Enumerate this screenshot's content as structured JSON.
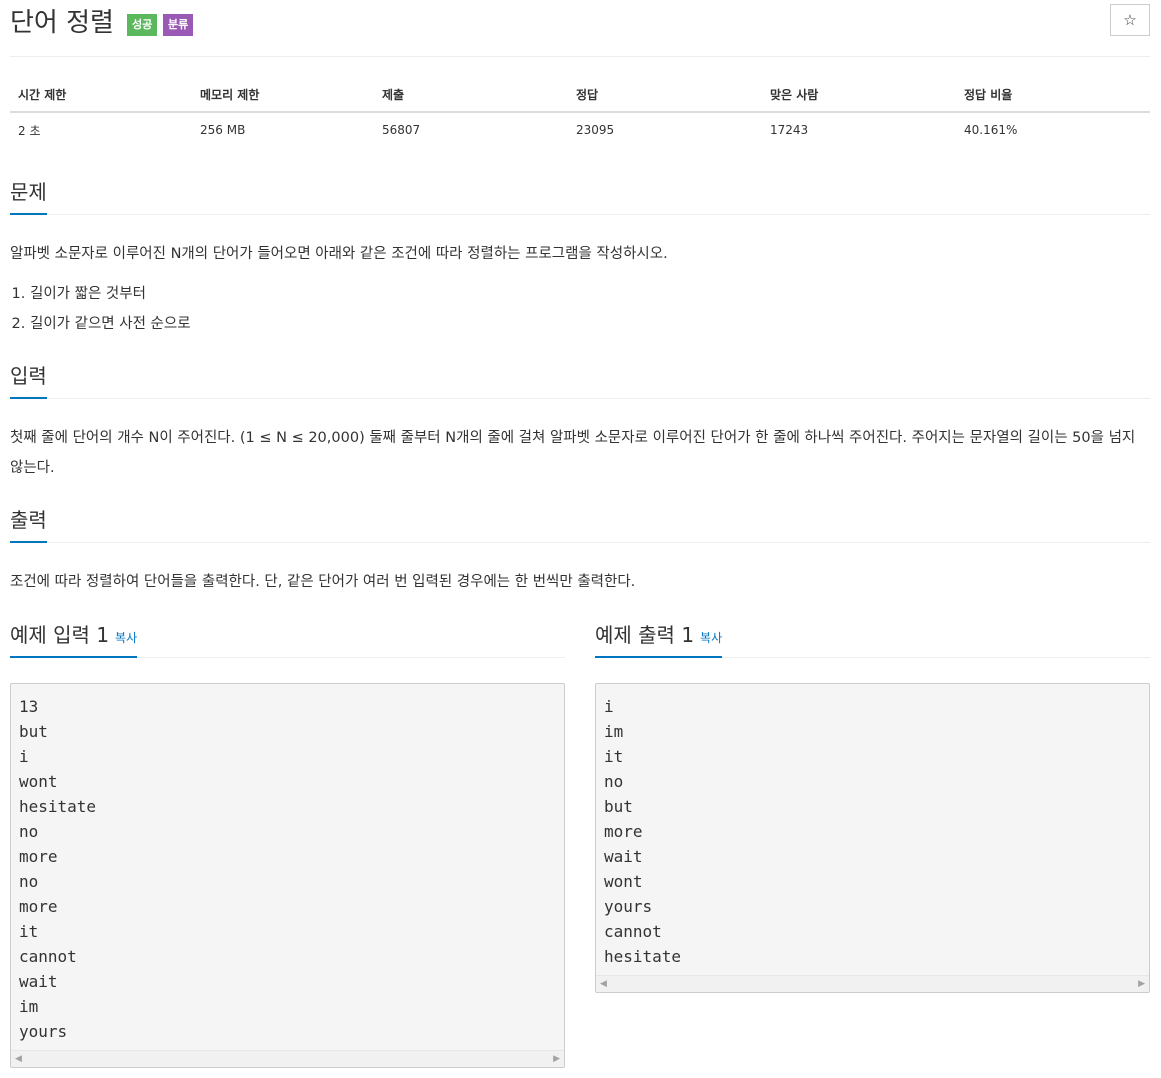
{
  "problem": {
    "title": "단어 정렬",
    "badges": {
      "success": "성공",
      "category": "분류"
    },
    "star_icon": "☆"
  },
  "info": {
    "headers": [
      "시간 제한",
      "메모리 제한",
      "제출",
      "정답",
      "맞은 사람",
      "정답 비율"
    ],
    "values": [
      "2 초",
      "256 MB",
      "56807",
      "23095",
      "17243",
      "40.161%"
    ]
  },
  "sections": {
    "description": {
      "heading": "문제",
      "text": "알파벳 소문자로 이루어진 N개의 단어가 들어오면 아래와 같은 조건에 따라 정렬하는 프로그램을 작성하시오.",
      "list": [
        "길이가 짧은 것부터",
        "길이가 같으면 사전 순으로"
      ]
    },
    "input": {
      "heading": "입력",
      "text": "첫째 줄에 단어의 개수 N이 주어진다. (1 ≤ N ≤ 20,000) 둘째 줄부터 N개의 줄에 걸쳐 알파벳 소문자로 이루어진 단어가 한 줄에 하나씩 주어진다. 주어지는 문자열의 길이는 50을 넘지 않는다."
    },
    "output": {
      "heading": "출력",
      "text": "조건에 따라 정렬하여 단어들을 출력한다. 단, 같은 단어가 여러 번 입력된 경우에는 한 번씩만 출력한다."
    }
  },
  "samples": {
    "input": {
      "heading": "예제 입력 1",
      "copy_label": "복사",
      "content": "13\nbut\ni\nwont\nhesitate\nno\nmore\nno\nmore\nit\ncannot\nwait\nim\nyours"
    },
    "output": {
      "heading": "예제 출력 1",
      "copy_label": "복사",
      "content": "i\nim\nit\nno\nbut\nmore\nwait\nwont\nyours\ncannot\nhesitate"
    }
  },
  "colors": {
    "accent": "#0076c0",
    "success": "#5cb85c",
    "category": "#9b59b6"
  }
}
